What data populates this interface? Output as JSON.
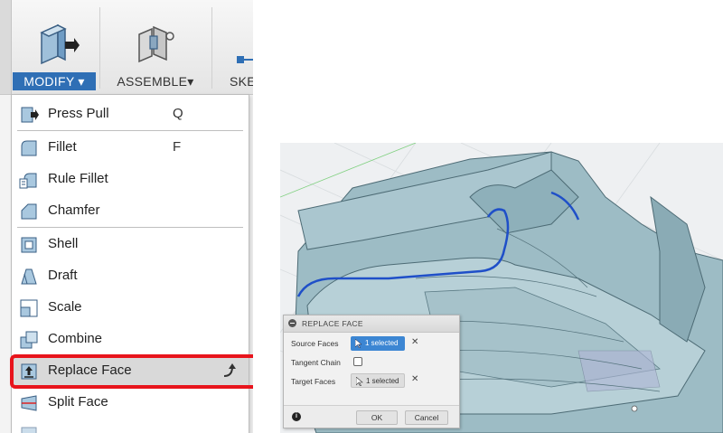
{
  "toolbar": {
    "modify_label": "MODIFY ▾",
    "assemble_label": "ASSEMBLE▾",
    "sketch_label": "SKE"
  },
  "menu": {
    "items": [
      {
        "label": "Press Pull",
        "shortcut": "Q",
        "icon": "press-pull-icon"
      },
      {
        "label": "Fillet",
        "shortcut": "F",
        "icon": "fillet-icon"
      },
      {
        "label": "Rule Fillet",
        "icon": "rule-fillet-icon"
      },
      {
        "label": "Chamfer",
        "icon": "chamfer-icon"
      },
      {
        "label": "Shell",
        "icon": "shell-icon"
      },
      {
        "label": "Draft",
        "icon": "draft-icon"
      },
      {
        "label": "Scale",
        "icon": "scale-icon"
      },
      {
        "label": "Combine",
        "icon": "combine-icon"
      },
      {
        "label": "Replace Face",
        "icon": "replace-face-icon",
        "highlighted": true
      },
      {
        "label": "Split Face",
        "icon": "split-face-icon"
      }
    ],
    "highlight_color": "#e8141c"
  },
  "dialog": {
    "title": "REPLACE FACE",
    "source_faces_label": "Source Faces",
    "source_faces_value": "1 selected",
    "tangent_chain_label": "Tangent Chain",
    "target_faces_label": "Target Faces",
    "target_faces_value": "1 selected",
    "clear_symbol": "✕",
    "info_symbol": "i",
    "ok_label": "OK",
    "cancel_label": "Cancel"
  },
  "colors": {
    "accent": "#2f6fb5",
    "selection_edge": "#1f4fc8",
    "model_fill": "#8fb3bf"
  }
}
